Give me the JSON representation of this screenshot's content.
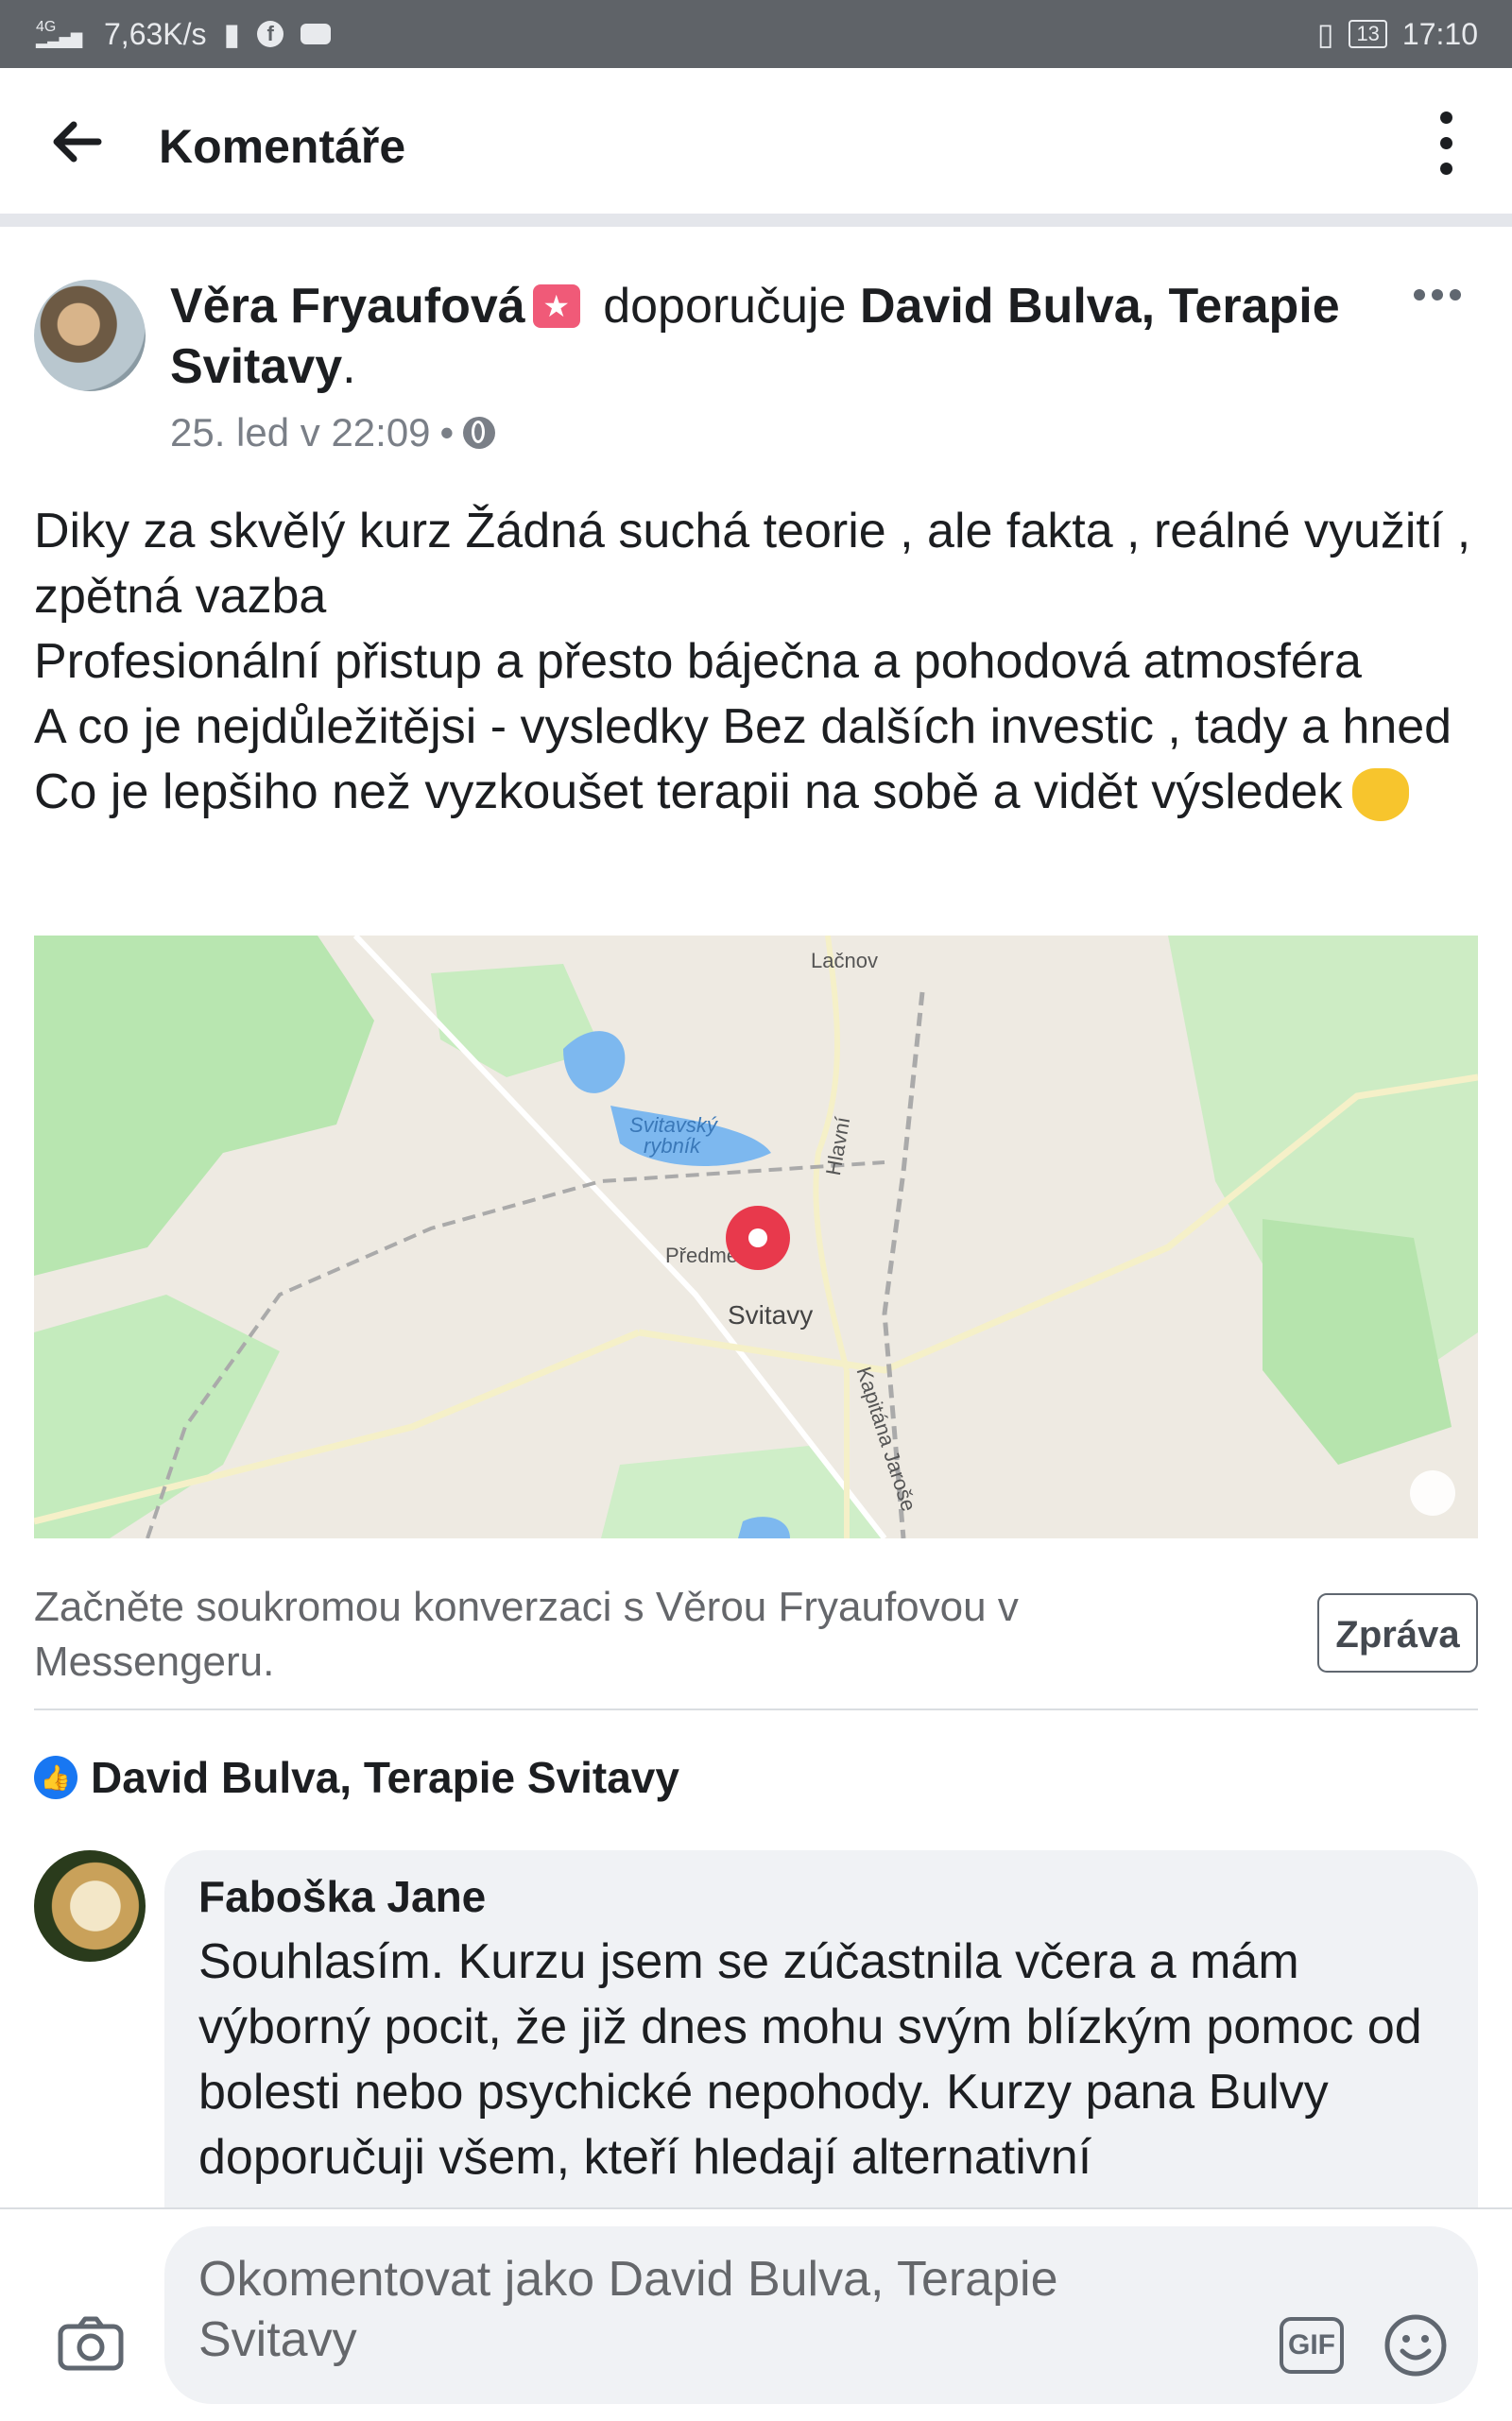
{
  "status_bar": {
    "network": "4G",
    "speed": "7,63K/s",
    "battery": "13",
    "time": "17:10",
    "icons": [
      "signal-icon",
      "alert-icon",
      "facebook-icon",
      "youtube-icon",
      "vibrate-icon",
      "battery-icon"
    ]
  },
  "app_bar": {
    "title": "Komentáře",
    "icons": [
      "back-arrow-icon",
      "more-vertical-icon"
    ]
  },
  "post": {
    "author": "Věra Fryaufová",
    "verb": "doporučuje",
    "page": "David Bulva, Terapie Svitavy",
    "suffix": ".",
    "time": "25. led v 22:09",
    "separator": "•",
    "body": "Diky za skvělý kurz Žádná suchá teorie , ale fakta , reálné využití , zpětná vazba\nProfesionální přistup a přesto báječna a pohodová atmosféra\nA co je nejdůležitějsi - vysledky  Bez dalších investic , tady a hned Co je lepšiho než vyzkoušet terapii na sobě a vidět výsledek",
    "map": {
      "labels": {
        "north": "Lačnov",
        "lake": "Svitavský rybník",
        "street1": "Hlavní",
        "west": "Předměstí",
        "city": "Svitavy",
        "street2": "Kapitána Jaroše"
      },
      "pin_color": "#e8394c"
    }
  },
  "messenger": {
    "prompt": "Začněte soukromou konverzaci s Věrou Fryaufovou v Messengeru.",
    "button": "Zpráva"
  },
  "like_row": {
    "name": "David Bulva, Terapie Svitavy",
    "color": "#1877f2"
  },
  "comment": {
    "author": "Faboška Jane",
    "text": "Souhlasím. Kurzu jsem se zúčastnila včera a mám výborný pocit, že již dnes mohu svým blízkým pomoc od bolesti nebo psychické nepohody. Kurzy pana Bulvy doporučuji všem, kteří hledají alternativní"
  },
  "composer": {
    "placeholder": "Okomentovat jako David Bulva, Terapie Svitavy",
    "gif_label": "GIF",
    "icons": [
      "camera-icon",
      "gif-icon",
      "emoji-icon"
    ]
  }
}
